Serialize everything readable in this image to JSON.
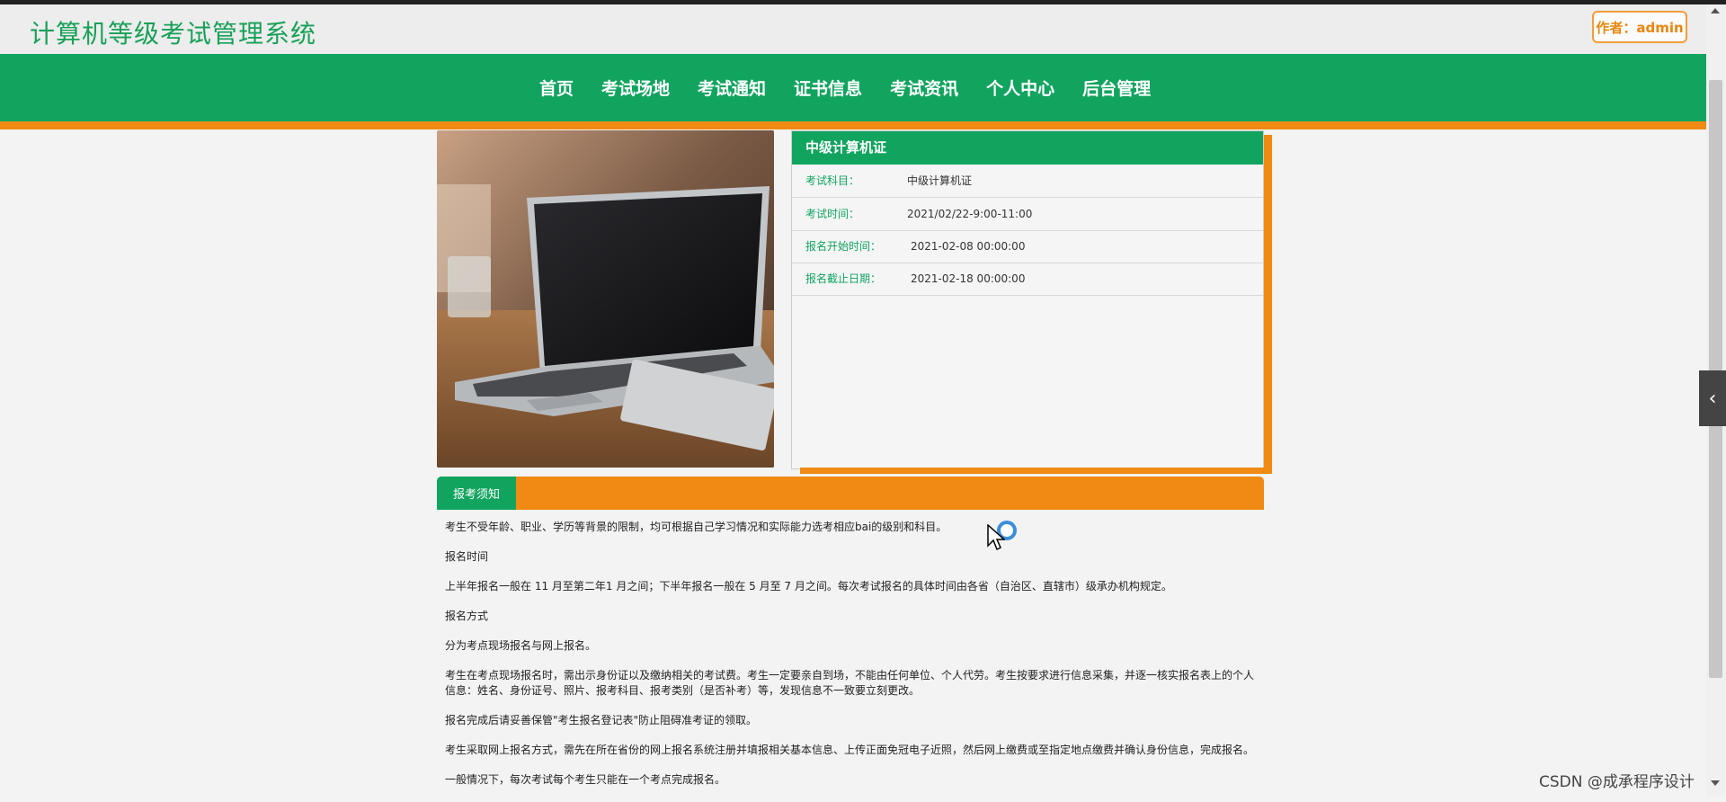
{
  "header": {
    "site_title": "计算机等级考试管理系统",
    "author_badge": "作者：admin"
  },
  "nav": {
    "items": [
      "首页",
      "考试场地",
      "考试通知",
      "证书信息",
      "考试资讯",
      "个人中心",
      "后台管理"
    ]
  },
  "detail": {
    "image_alt": "laptop on wooden desk",
    "title": "中级计算机证",
    "rows": [
      {
        "label": "考试科目：",
        "value": "中级计算机证"
      },
      {
        "label": "考试时间：",
        "value": "2021/02/22-9:00-11:00"
      },
      {
        "label": "报名开始时间：",
        "value": "2021-02-08 00:00:00"
      },
      {
        "label": "报名截止日期：",
        "value": "2021-02-18 00:00:00"
      }
    ]
  },
  "notice": {
    "tab_label": "报考须知",
    "paragraphs": [
      "考生不受年龄、职业、学历等背景的限制，均可根据自己学习情况和实际能力选考相应bai的级别和科目。",
      "报名时间",
      "上半年报名一般在 11 月至第二年1 月之间；下半年报名一般在 5 月至 7 月之间。每次考试报名的具体时间由各省（自治区、直辖市）级承办机构规定。",
      "报名方式",
      "分为考点现场报名与网上报名。",
      "考生在考点现场报名时，需出示身份证以及缴纳相关的考试费。考生一定要亲自到场，不能由任何单位、个人代劳。考生按要求进行信息采集，并逐一核实报名表上的个人信息：姓名、身份证号、照片、报考科目、报考类别（是否补考）等，发现信息不一致要立刻更改。",
      "报名完成后请妥善保管\"考生报名登记表\"防止阻碍准考证的领取。",
      "考生采取网上报名方式，需先在所在省份的网上报名系统注册并填报相关基本信息、上传正面免冠电子近照，然后网上缴费或至指定地点缴费并确认身份信息，完成报名。",
      "一般情况下，每次考试每个考生只能在一个考点完成报名。"
    ]
  },
  "watermark": "CSDN @成承程序设计",
  "colors": {
    "brand_green": "#11a45f",
    "accent_orange": "#f18a13"
  },
  "icons": {
    "side_toggle": "chevron-left-icon",
    "cursor": "mouse-pointer-icon"
  }
}
